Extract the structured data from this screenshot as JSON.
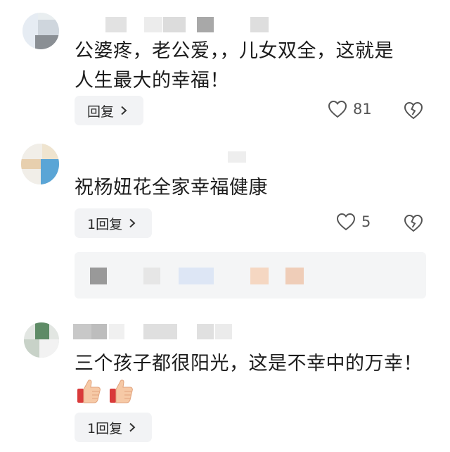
{
  "comments": [
    {
      "text_line1": "公婆疼，老公爱，，儿女双全，这就是",
      "text_line2": "人生最大的幸福！",
      "reply_label": "回复",
      "like_count": "81"
    },
    {
      "text_line1": "祝杨妞花全家幸福健康",
      "reply_label": "1回复",
      "like_count": "5"
    },
    {
      "text_line1": "三个孩子都很阳光，这是不幸中的万幸！",
      "reply_label": "1回复",
      "emoji_names": [
        "thumbs-up-emoji",
        "thumbs-up-emoji"
      ]
    }
  ],
  "icons": {
    "like": "heart-outline-icon",
    "dislike": "broken-heart-icon",
    "chevron": "chevron-right-icon"
  }
}
